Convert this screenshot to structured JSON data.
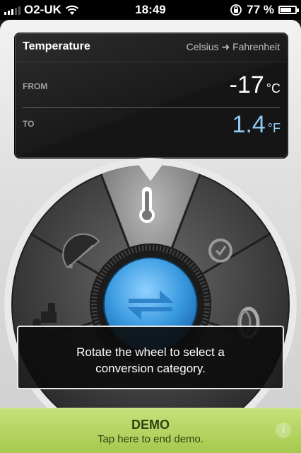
{
  "status_bar": {
    "carrier": "O2-UK",
    "time": "18:49",
    "battery_percent": "77 %",
    "battery_level": 0.77
  },
  "display": {
    "category": "Temperature",
    "from_unit_name": "Celsius",
    "arrow": "➜",
    "to_unit_name": "Fahrenheit",
    "from_label": "FROM",
    "from_value": "-17",
    "from_unit": "°C",
    "to_label": "TO",
    "to_value": "1.4",
    "to_unit": "°F"
  },
  "wheel": {
    "segments": [
      {
        "icon": "thermometer-icon",
        "selected": true
      },
      {
        "icon": "gauge-icon"
      },
      {
        "icon": "clock-icon"
      },
      {
        "icon": "faucet-icon"
      },
      {
        "icon": "tire-icon"
      }
    ],
    "center_button_icon": "swap-arrows-icon"
  },
  "tooltip": {
    "text_line1": "Rotate the wheel to select a",
    "text_line2": "conversion category."
  },
  "demo_bar": {
    "title": "DEMO",
    "subtitle": "Tap here to end demo.",
    "info_symbol": "i"
  },
  "colors": {
    "accent_blue": "#3a9be0",
    "to_value_color": "#8ccbf3",
    "demo_green": "#b4d45e"
  }
}
